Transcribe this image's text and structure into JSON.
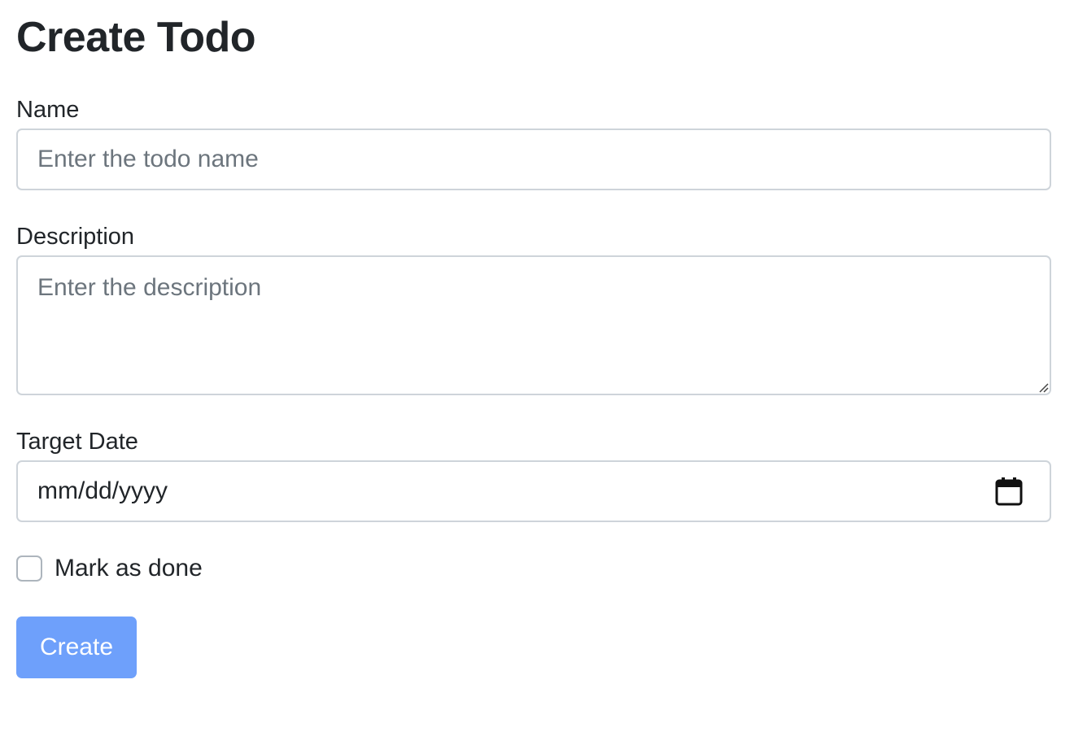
{
  "page": {
    "title": "Create Todo"
  },
  "form": {
    "name": {
      "label": "Name",
      "placeholder": "Enter the todo name",
      "value": ""
    },
    "description": {
      "label": "Description",
      "placeholder": "Enter the description",
      "value": ""
    },
    "target_date": {
      "label": "Target Date",
      "display_value": "mm/dd/yyyy",
      "icon": "calendar-icon"
    },
    "done": {
      "label": "Mark as done",
      "checked": false
    },
    "submit": {
      "label": "Create"
    }
  },
  "colors": {
    "text": "#212529",
    "placeholder": "#6c757d",
    "border": "#ced4da",
    "button_bg": "#6ea0fb",
    "button_text": "#ffffff"
  }
}
